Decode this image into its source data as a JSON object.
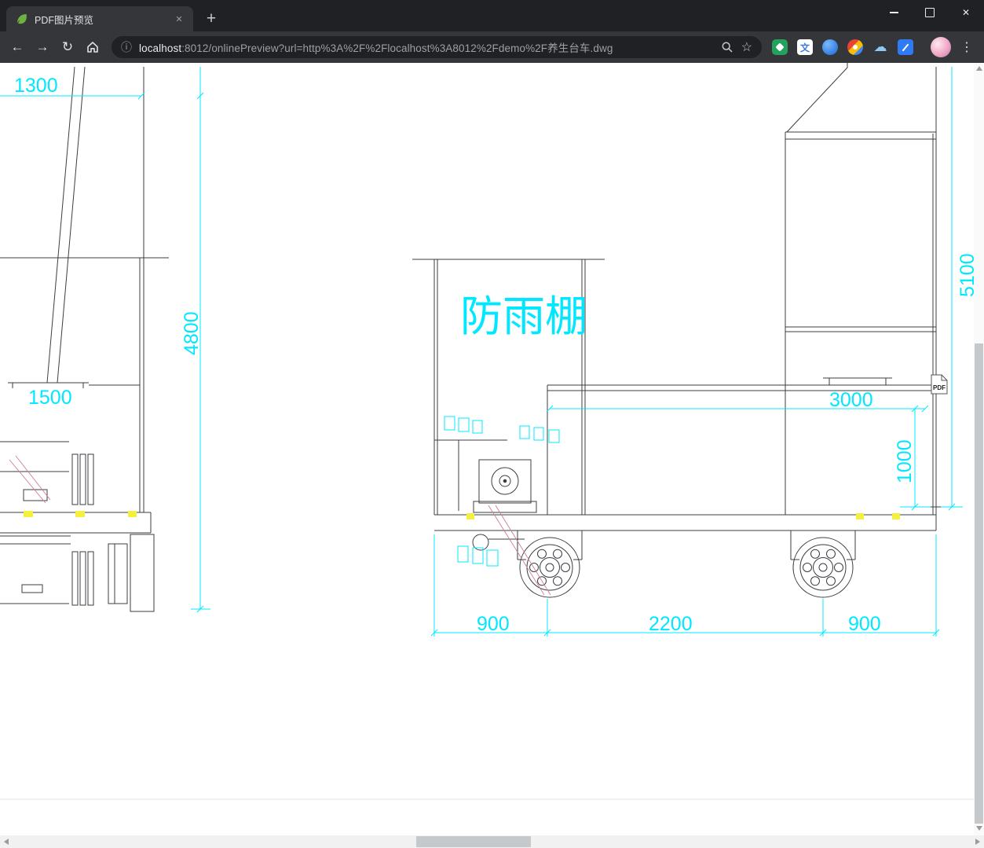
{
  "colors": {
    "frame_bg": "#202124",
    "toolbar_bg": "#35363a",
    "omnibox_bg": "#202124",
    "dimension_cyan": "#00e8ff",
    "cad_line": "#3a3d42",
    "marker_yellow": "#f5ef3d",
    "leader_pink": "#cf7e95",
    "favicon_green": "#6db33f"
  },
  "tabstrip": {
    "tab_title": "PDF图片预览",
    "favicon": "spring-leaf-icon",
    "close_glyph": "✕",
    "new_tab_glyph": "+",
    "window_controls": {
      "minimize": "minimize-icon",
      "maximize": "maximize-icon",
      "close_glyph": "✕"
    }
  },
  "navbar": {
    "back_glyph": "←",
    "forward_glyph": "→",
    "reload_glyph": "↻",
    "home_icon": "home-icon",
    "info_glyph": "ⓘ",
    "url_host": "localhost",
    "url_rest": ":8012/onlinePreview?url=http%3A%2F%2Flocalhost%3A8012%2Fdemo%2F养生台车.dwg",
    "zoom_icon": "magnifier-icon",
    "star_glyph": "☆",
    "menu_glyph": "⋮",
    "icons": {
      "translate_glyph": "文",
      "cloud_glyph": "☁"
    },
    "extensions": [
      "extension-green",
      "extension-translate",
      "extension-blue-ball",
      "extension-colorful",
      "extension-cloud",
      "extension-blue"
    ]
  },
  "drawing": {
    "shelter_label": "防雨棚",
    "pdf_badge": "PDF",
    "dims": {
      "top_width": "1300",
      "left_height": "4800",
      "platform_width": "1500",
      "right_height": "5100",
      "deck_width": "3000",
      "deck_height": "1000",
      "front_overhang": "900",
      "wheelbase": "2200",
      "rear_overhang": "900"
    }
  }
}
